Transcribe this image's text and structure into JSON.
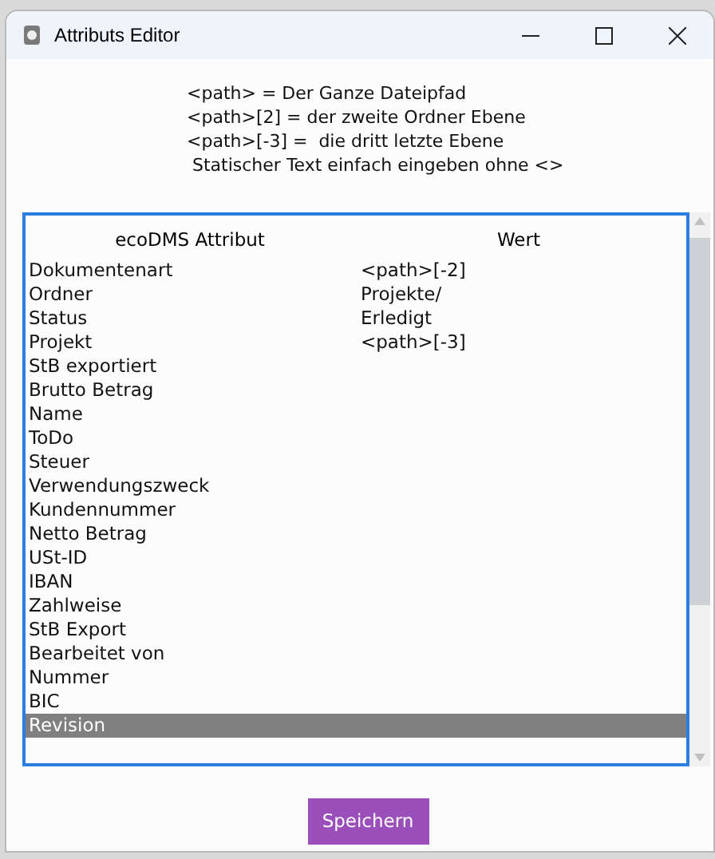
{
  "window": {
    "title": "Attributs Editor"
  },
  "help_lines": [
    "<path> = Der Ganze Dateipfad",
    "<path>[2] = der zweite Ordner Ebene",
    "<path>[-3] =  die dritt letzte Ebene",
    " Statischer Text einfach eingeben ohne <>"
  ],
  "table": {
    "columns": [
      "ecoDMS Attribut",
      "Wert"
    ],
    "rows": [
      {
        "attribute": "Dokumentenart",
        "value": "<path>[-2]",
        "selected": false
      },
      {
        "attribute": "Ordner",
        "value": "Projekte/",
        "selected": false
      },
      {
        "attribute": "Status",
        "value": "Erledigt",
        "selected": false
      },
      {
        "attribute": "Projekt",
        "value": "<path>[-3]",
        "selected": false
      },
      {
        "attribute": "StB exportiert",
        "selected": false
      },
      {
        "attribute": "Brutto Betrag",
        "selected": false
      },
      {
        "attribute": "Name",
        "selected": false
      },
      {
        "attribute": "ToDo",
        "selected": false
      },
      {
        "attribute": "Steuer",
        "selected": false
      },
      {
        "attribute": "Verwendungszweck",
        "selected": false
      },
      {
        "attribute": "Kundennummer",
        "selected": false
      },
      {
        "attribute": "Netto Betrag",
        "selected": false
      },
      {
        "attribute": "USt-ID",
        "selected": false
      },
      {
        "attribute": "IBAN",
        "selected": false
      },
      {
        "attribute": "Zahlweise",
        "selected": false
      },
      {
        "attribute": "StB Export",
        "selected": false
      },
      {
        "attribute": "Bearbeitet von",
        "selected": false
      },
      {
        "attribute": "Nummer",
        "selected": false
      },
      {
        "attribute": "BIC",
        "selected": false
      },
      {
        "attribute": "Revision",
        "selected": true
      }
    ]
  },
  "save_button": "Speichern"
}
